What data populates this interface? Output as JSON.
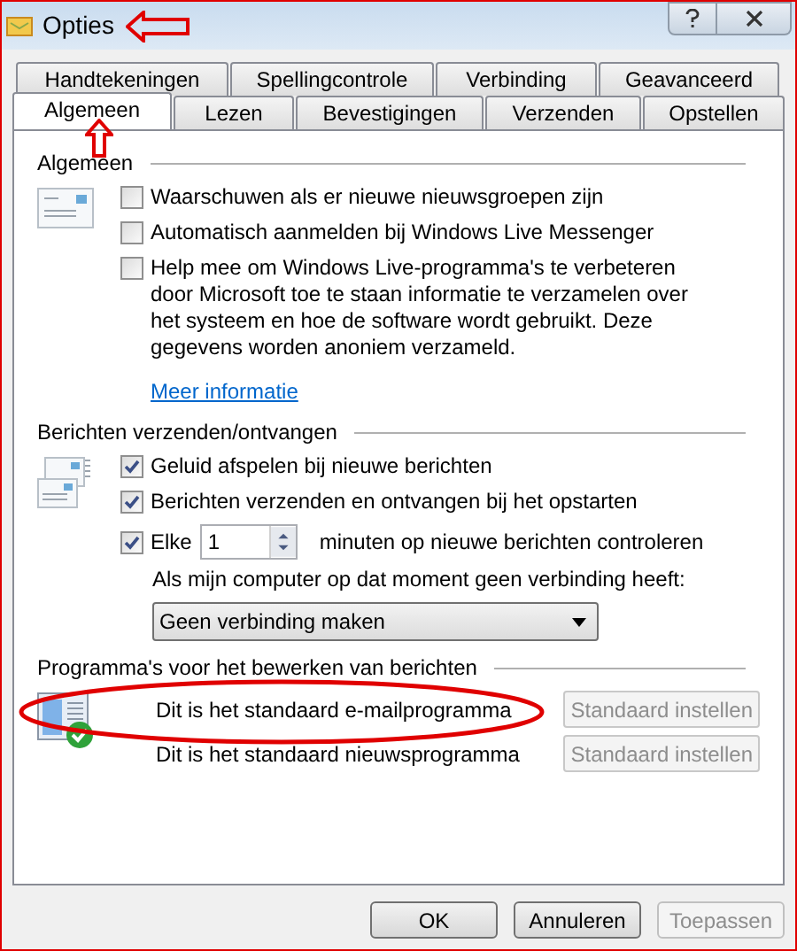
{
  "window": {
    "title": "Opties"
  },
  "tabs_row_1": [
    {
      "label": "Handtekeningen",
      "selected": false
    },
    {
      "label": "Spellingcontrole",
      "selected": false
    },
    {
      "label": "Verbinding",
      "selected": false
    },
    {
      "label": "Geavanceerd",
      "selected": false
    }
  ],
  "tabs_row_2": [
    {
      "label": "Algemeen",
      "selected": true
    },
    {
      "label": "Lezen",
      "selected": false
    },
    {
      "label": "Bevestigingen",
      "selected": false
    },
    {
      "label": "Verzenden",
      "selected": false
    },
    {
      "label": "Opstellen",
      "selected": false
    }
  ],
  "sections": [
    {
      "title": "Algemeen",
      "kind": "envelope",
      "items": [
        {
          "kind": "checkbox",
          "label": "Waarschuwen als er nieuwe nieuwsgroepen zijn",
          "checked": false
        },
        {
          "kind": "checkbox",
          "label": "Automatisch aanmelden bij Windows Live Messenger",
          "checked": false
        },
        {
          "kind": "checkbox",
          "label": "Help mee om Windows Live-programma's te verbeteren door Microsoft toe te staan informatie te verzamelen over het systeem en hoe de software wordt gebruikt. Deze gegevens worden anoniem verzameld.",
          "checked": false
        },
        {
          "kind": "link",
          "label": "Meer informatie"
        }
      ]
    },
    {
      "title": "Berichten verzenden/ontvangen",
      "kind": "envelopes",
      "items": [
        {
          "kind": "checkbox",
          "label": "Geluid afspelen bij nieuwe berichten",
          "checked": true
        },
        {
          "kind": "checkbox",
          "label": "Berichten verzenden en ontvangen bij het opstarten",
          "checked": true
        },
        {
          "kind": "interval",
          "label": "Elke",
          "checked": true,
          "value": "1",
          "suffix": "minuten op nieuwe berichten controleren"
        },
        {
          "kind": "note",
          "label": "Als mijn computer op dat moment geen verbinding heeft:"
        },
        {
          "kind": "dropdown",
          "value": "Geen verbinding maken"
        }
      ]
    },
    {
      "title": "Programma's voor het bewerken van berichten",
      "kind": "program_check",
      "items": [
        {
          "kind": "default_row",
          "label": "Dit is het standaard e-mailprogramma",
          "button": {
            "label": "Standaard instellen",
            "disabled": true
          }
        },
        {
          "kind": "default_row",
          "label": "Dit is het standaard nieuwsprogramma",
          "button": {
            "label": "Standaard instellen",
            "disabled": true
          }
        }
      ]
    }
  ],
  "buttons": [
    {
      "label": "OK",
      "disabled": false
    },
    {
      "label": "Annuleren",
      "disabled": false
    },
    {
      "label": "Toepassen",
      "disabled": true
    }
  ]
}
